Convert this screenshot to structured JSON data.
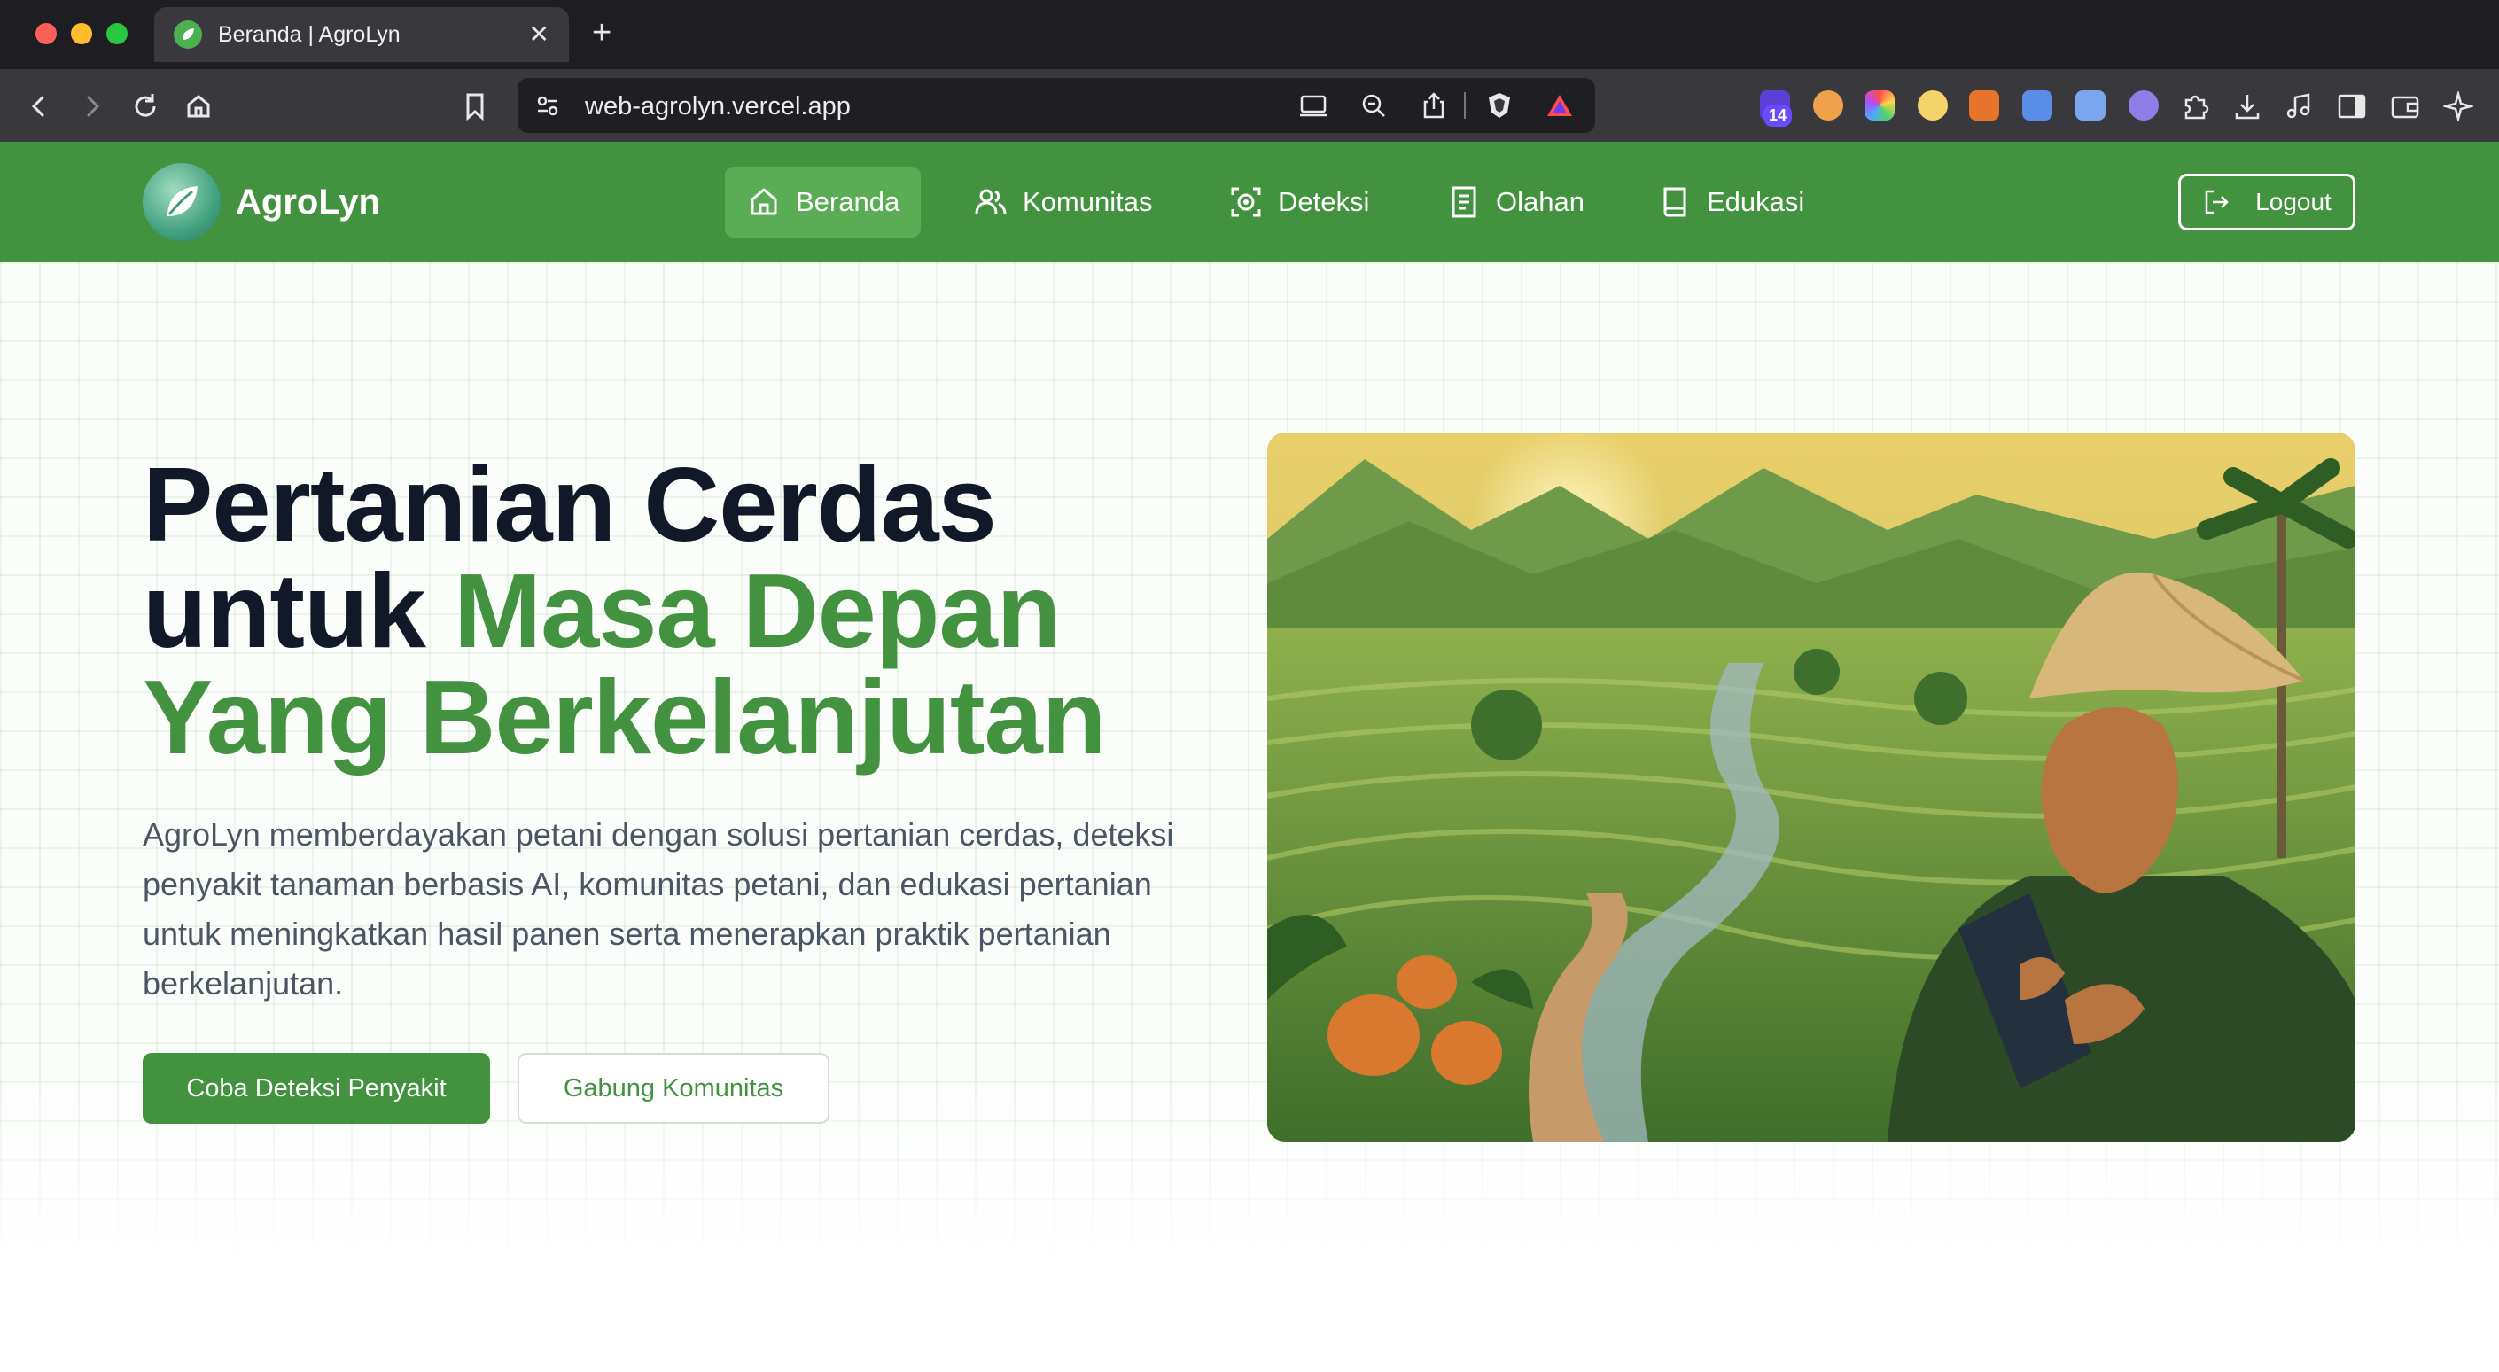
{
  "browser": {
    "tab_title": "Beranda | AgroLyn",
    "url": "web-agrolyn.vercel.app",
    "extension_badge": "14"
  },
  "site": {
    "brand": "AgroLyn",
    "nav": [
      {
        "label": "Beranda",
        "icon": "home-icon",
        "active": true
      },
      {
        "label": "Komunitas",
        "icon": "users-icon"
      },
      {
        "label": "Deteksi",
        "icon": "scan-icon"
      },
      {
        "label": "Olahan",
        "icon": "document-icon"
      },
      {
        "label": "Edukasi",
        "icon": "book-icon"
      }
    ],
    "logout_label": "Logout"
  },
  "hero": {
    "title_line1": "Pertanian Cerdas",
    "title_line2_plain": "untuk ",
    "title_line2_green": "Masa Depan",
    "title_line3_green": "Yang Berkelanjutan",
    "description": "AgroLyn memberdayakan petani dengan solusi pertanian cerdas, deteksi penyakit tanaman berbasis AI, komunitas petani, dan edukasi pertanian untuk meningkatkan hasil panen serta menerapkan praktik pertanian berkelanjutan.",
    "primary_button": "Coba Deteksi Penyakit",
    "secondary_button": "Gabung Komunitas"
  },
  "colors": {
    "brand_green": "#43923f",
    "nav_active": "#5aad55",
    "headline_dark": "#111827"
  }
}
